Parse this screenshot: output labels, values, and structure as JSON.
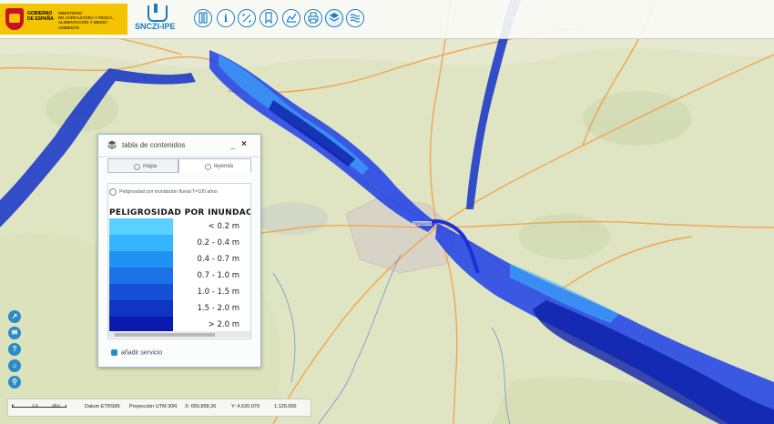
{
  "header": {
    "ministry_lines": [
      "MINISTERIO",
      "DE AGRICULTURA Y PESCA,",
      "ALIMENTACIÓN Y MEDIO AMBIENTE"
    ],
    "gov_lines": [
      "GOBIERNO",
      "DE ESPAÑA"
    ],
    "app_name": "SNCZI-IPE"
  },
  "toolbar": {
    "tools": [
      {
        "name": "layers-panel-tool",
        "icon": "panel-icon"
      },
      {
        "name": "info-tool",
        "icon": "info-icon",
        "glyph": "i"
      },
      {
        "name": "measure-tool",
        "icon": "measure-icon"
      },
      {
        "name": "bookmark-tool",
        "icon": "bookmark-icon"
      },
      {
        "name": "profile-tool",
        "icon": "profile-icon"
      },
      {
        "name": "print-tool",
        "icon": "print-icon"
      },
      {
        "name": "layers-tool",
        "icon": "layers-icon"
      },
      {
        "name": "water-tool",
        "icon": "water-icon"
      }
    ]
  },
  "toc": {
    "title": "tabla de contenidos",
    "minimize": "_",
    "close": "×",
    "tabs": {
      "mapa": "mapa",
      "leyenda": "leyenda"
    },
    "layer_name": "Peligrosidad por inundación fluvial T=100 años",
    "legend_title": "PELIGROSIDAD POR INUNDACI",
    "classes": [
      {
        "label": "< 0.2 m",
        "color": "#5ad0ff"
      },
      {
        "label": "0.2 - 0.4 m",
        "color": "#34b6ff"
      },
      {
        "label": "0.4 - 0.7 m",
        "color": "#1f93f4"
      },
      {
        "label": "0.7 - 1.0 m",
        "color": "#1b72e6"
      },
      {
        "label": "1.0 - 1.5 m",
        "color": "#1551d8"
      },
      {
        "label": "1.5 - 2.0 m",
        "color": "#1034c4"
      },
      {
        "label": "> 2.0 m",
        "color": "#0a1ab0"
      }
    ],
    "add_service": "añadir servicio"
  },
  "sidebar": {
    "buttons": [
      {
        "name": "share-button",
        "icon": "share-icon",
        "glyph": "↗"
      },
      {
        "name": "mail-button",
        "icon": "mail-icon",
        "glyph": "✉"
      },
      {
        "name": "help-button",
        "icon": "help-icon",
        "glyph": "?"
      },
      {
        "name": "home-button",
        "icon": "home-icon",
        "glyph": "⌂"
      },
      {
        "name": "zoom-button",
        "icon": "zoom-icon",
        "glyph": "⚲"
      }
    ]
  },
  "statusbar": {
    "scale_labels": [
      "0",
      "1.5",
      "3km"
    ],
    "datum": "Datum ETRS89",
    "projection": "Proyección UTM 30N",
    "x": "X: 655.858,36",
    "y": "Y: 4.620.079",
    "scale": "1:125.000"
  },
  "map": {
    "city": "Zaragoza"
  }
}
